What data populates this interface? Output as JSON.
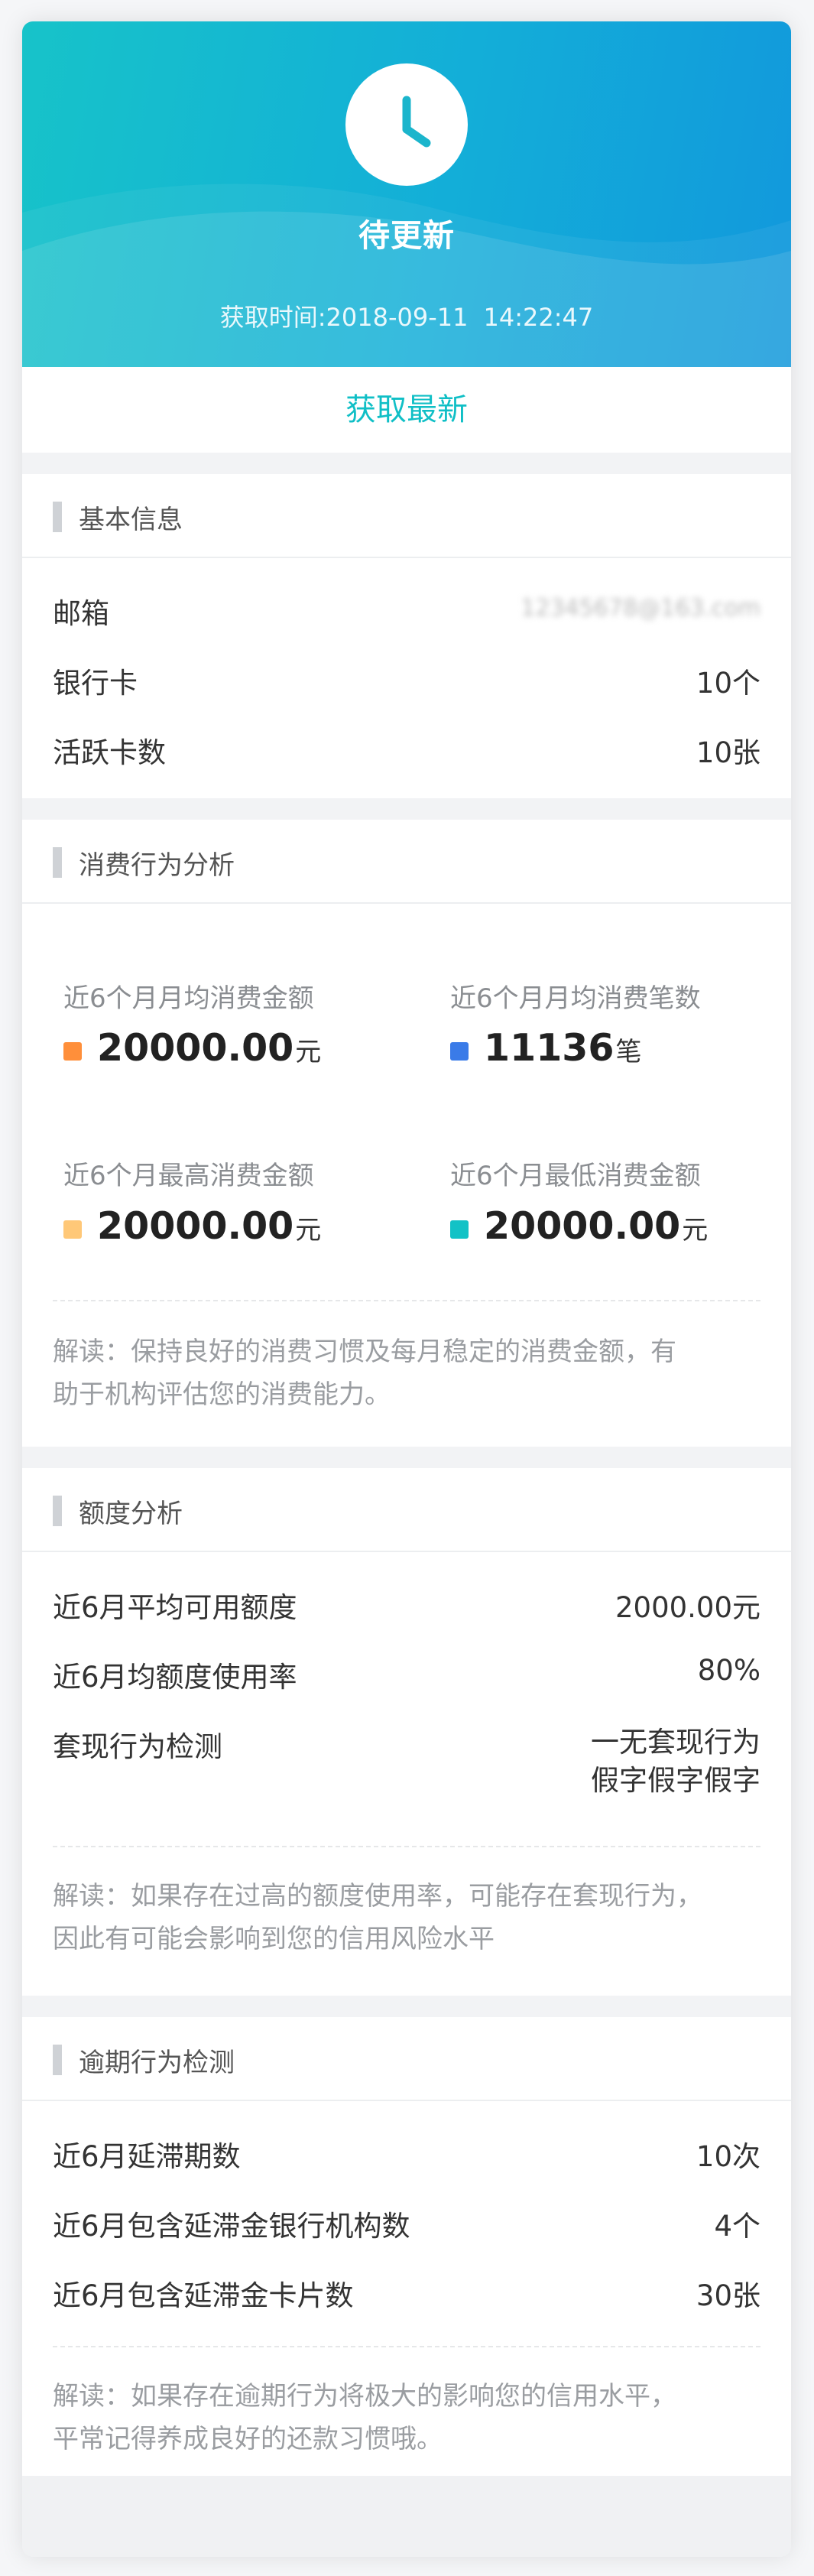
{
  "header": {
    "status_title": "待更新",
    "fetch_time_label": "获取时间:",
    "fetch_date": "2018-09-11",
    "fetch_clock": "14:22:47",
    "refresh_button": "获取最新",
    "icon": "clock-icon"
  },
  "basic_info": {
    "title": "基本信息",
    "rows": [
      {
        "label": "邮箱",
        "value": "12345678@163.com"
      },
      {
        "label": "银行卡",
        "value": "10个"
      },
      {
        "label": "活跃卡数",
        "value": "10张"
      }
    ]
  },
  "consumption": {
    "title": "消费行为分析",
    "stats": [
      {
        "label": "近6个月月均消费金额",
        "value": "20000.00",
        "unit": "元",
        "color": "#ff8f3a"
      },
      {
        "label": "近6个月月均消费笔数",
        "value": "11136",
        "unit": "笔",
        "color": "#3a7be8"
      },
      {
        "label": "近6个月最高消费金额",
        "value": "20000.00",
        "unit": "元",
        "color": "#ffc878"
      },
      {
        "label": "近6个月最低消费金额",
        "value": "20000.00",
        "unit": "元",
        "color": "#12c2c6"
      }
    ],
    "note_line1": "解读：保持良好的消费习惯及每月稳定的消费金额，有",
    "note_line2": "助于机构评估您的消费能力。"
  },
  "limit": {
    "title": "额度分析",
    "rows": [
      {
        "label": "近6月平均可用额度",
        "value": "2000.00元"
      },
      {
        "label": "近6月均额度使用率",
        "value": "80%"
      },
      {
        "label": "套现行为检测",
        "value": "一无套现行为",
        "value2": "假字假字假字"
      }
    ],
    "note_line1": "解读：如果存在过高的额度使用率，可能存在套现行为，",
    "note_line2": "因此有可能会影响到您的信用风险水平"
  },
  "overdue": {
    "title": "逾期行为检测",
    "rows": [
      {
        "label": "近6月延滞期数",
        "value": "10次"
      },
      {
        "label": "近6月包含延滞金银行机构数",
        "value": "4个"
      },
      {
        "label": "近6月包含延滞金卡片数",
        "value": "30张"
      }
    ],
    "note_line1": "解读：如果存在逾期行为将极大的影响您的信用水平，",
    "note_line2": "平常记得养成良好的还款习惯哦。"
  }
}
